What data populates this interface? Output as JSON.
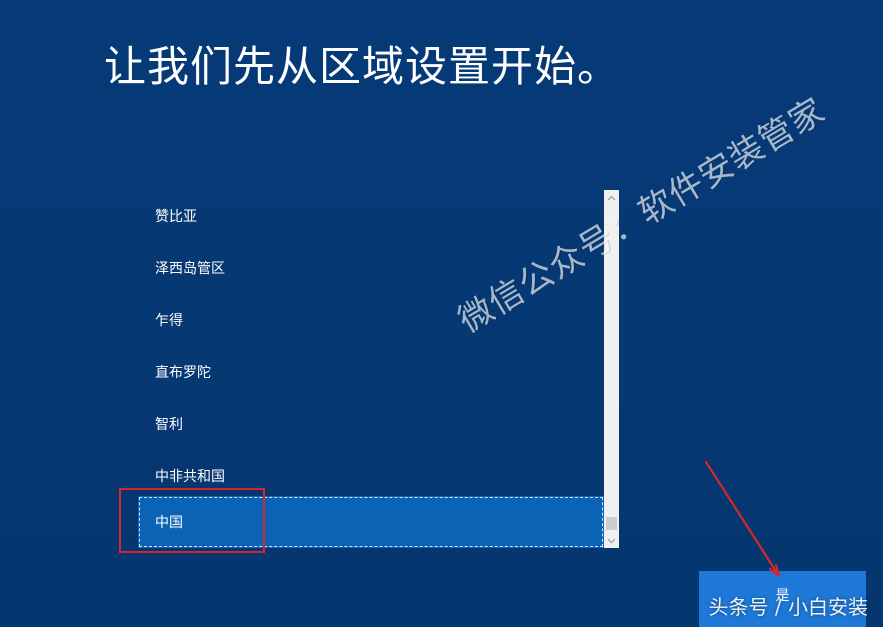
{
  "setup": {
    "title": "让我们先从区域设置开始。"
  },
  "regions": {
    "items": [
      {
        "label": "赞比亚",
        "selected": false
      },
      {
        "label": "泽西岛管区",
        "selected": false
      },
      {
        "label": "乍得",
        "selected": false
      },
      {
        "label": "直布罗陀",
        "selected": false
      },
      {
        "label": "智利",
        "selected": false
      },
      {
        "label": "中非共和国",
        "selected": false
      },
      {
        "label": "中国",
        "selected": true
      }
    ],
    "selected_value": "中国"
  },
  "actions": {
    "yes_label": "是"
  },
  "overlays": {
    "watermark_text": "微信公众号：软件安装管家",
    "footer_text": "头条号 / 小白安装"
  },
  "icons": {
    "scroll_up": "chevron-up-icon",
    "scroll_down": "chevron-down-icon"
  },
  "colors": {
    "background": "#063a78",
    "selected_item": "#0b63b5",
    "primary_button": "#1e78d7",
    "annotation_red": "#d7262b",
    "scrollbar": "#f0f0f0"
  }
}
